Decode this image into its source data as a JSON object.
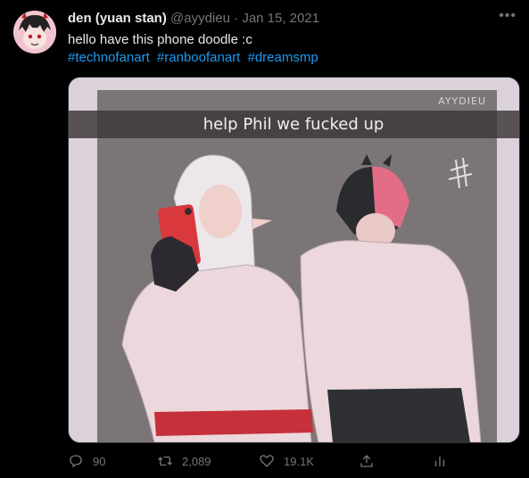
{
  "tweet": {
    "author_name": "den (yuan stan)",
    "handle": "@ayydieu",
    "separator": "·",
    "date": "Jan 15, 2021",
    "text": "hello have this phone doodle :c",
    "hashtags": [
      "#technofanart",
      "#ranboofanart",
      "#dreamsmp"
    ]
  },
  "media": {
    "caption": "help Phil we fucked up",
    "signature": "AYYDIEU"
  },
  "actions": {
    "replies": "90",
    "retweets": "2,089",
    "likes": "19.1K"
  },
  "icons": [
    "more-icon",
    "reply-icon",
    "retweet-icon",
    "like-icon",
    "share-icon",
    "analytics-icon"
  ],
  "colors": {
    "accent": "#1d9bf0",
    "muted": "#71767b",
    "background": "#000000"
  }
}
